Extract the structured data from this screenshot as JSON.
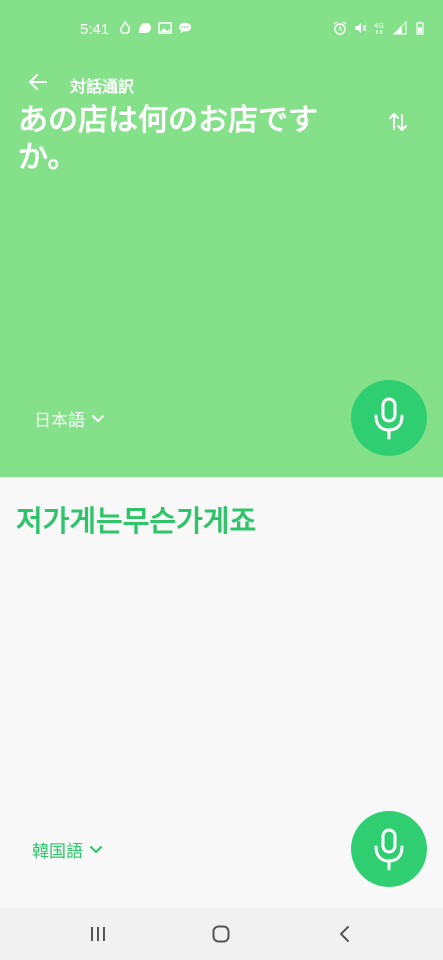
{
  "status_bar": {
    "time": "5:41",
    "left_icons": [
      "flame-icon",
      "bubble-icon",
      "image-icon",
      "chat-icon"
    ],
    "right_icons": [
      "alarm-icon",
      "mute-icon",
      "4g-icon",
      "signal-icon",
      "battery-icon"
    ]
  },
  "header": {
    "title": "対話通訳",
    "back_icon": "arrow-left-icon"
  },
  "source": {
    "text": "あの店は何のお店ですか。",
    "language": "日本語",
    "accent_color": "#85e08a"
  },
  "target": {
    "text": "저가게는무슨가게죠",
    "language": "韓国語",
    "text_color": "#2fc46a"
  },
  "icons": {
    "swap": "swap-vertical-icon",
    "mic": "microphone-icon",
    "dropdown": "chevron-down-icon"
  },
  "nav": {
    "recent": "recent-apps-icon",
    "home": "home-icon",
    "back": "back-icon"
  }
}
